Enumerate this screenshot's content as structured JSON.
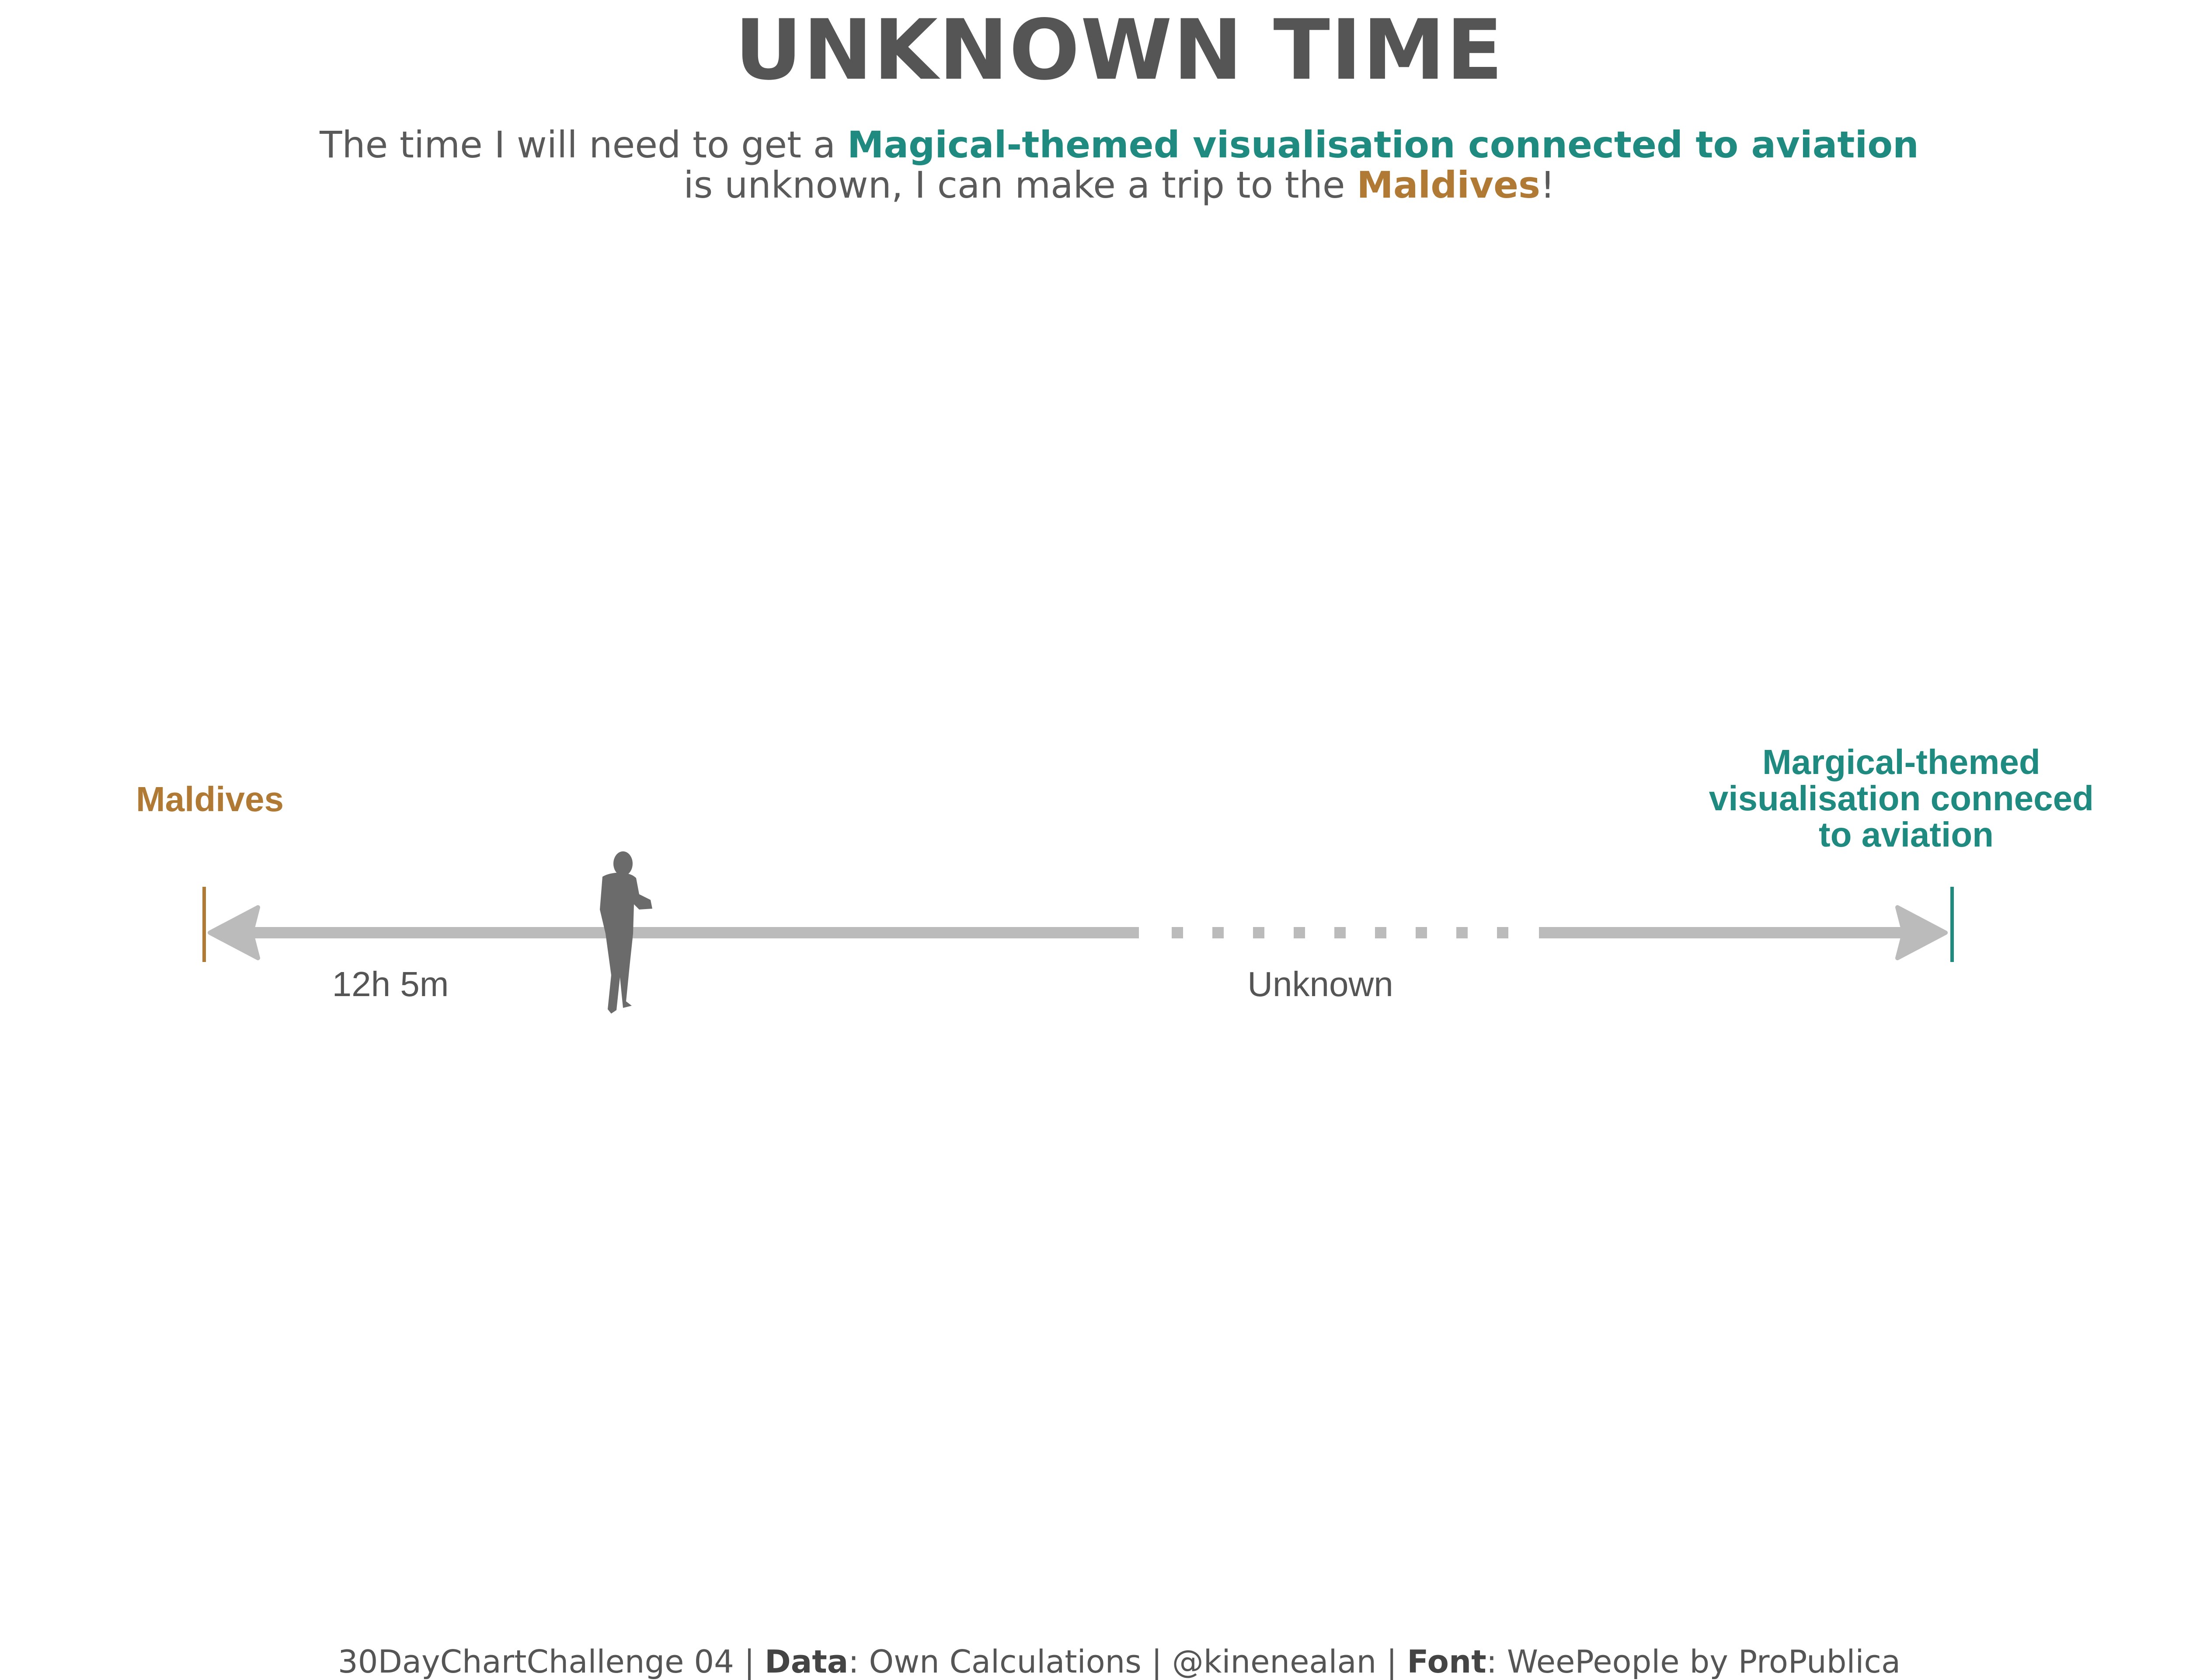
{
  "title": "UNKNOWN TIME",
  "subtitle": {
    "part1": "The time I will need to get a ",
    "highlight1": "Magical-themed visualisation connected to aviation",
    "part2": "is unknown, I can make a trip to the ",
    "highlight2": "Maldives",
    "part3": "!"
  },
  "caption": {
    "part1": "30DayChartChallenge 04 | ",
    "data_label": "Data",
    "part2": ": Own Calculations | @kinenealan | ",
    "font_label": "Font",
    "part3": ": WeePeople by ProPublica"
  },
  "colors": {
    "teal": "#1f8a80",
    "gold": "#b07a35",
    "line": "#bbbbbb",
    "person": "#6b6b6b",
    "text": "#555555"
  },
  "chart_data": {
    "type": "timeline",
    "start_label": "Maldives",
    "end_label_lines": [
      "Margical-themed",
      "visualisation conneced",
      "to aviation"
    ],
    "segments": [
      {
        "label": "12h 5m",
        "kind": "known"
      },
      {
        "label": "Unknown",
        "kind": "unknown"
      }
    ],
    "person_icon": "person-checking-watch-icon"
  }
}
